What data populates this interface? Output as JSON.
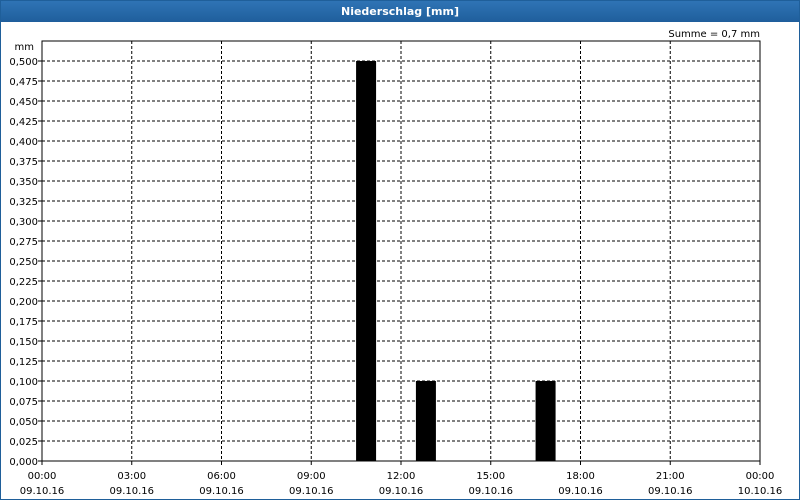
{
  "window": {
    "title": "Niederschlag [mm]"
  },
  "summary": "Summe = 0,7 mm",
  "chart_data": {
    "type": "bar",
    "title": "Niederschlag [mm]",
    "ylabel": "mm",
    "ylim": [
      0,
      0.5
    ],
    "yticks": [
      "0,000",
      "0,025",
      "0,050",
      "0,075",
      "0,100",
      "0,125",
      "0,150",
      "0,175",
      "0,200",
      "0,225",
      "0,250",
      "0,275",
      "0,300",
      "0,325",
      "0,350",
      "0,375",
      "0,400",
      "0,425",
      "0,450",
      "0,475",
      "0,500"
    ],
    "xlim_hours": [
      0,
      24
    ],
    "xticks": [
      {
        "time": "00:00",
        "date": "09.10.16"
      },
      {
        "time": "03:00",
        "date": "09.10.16"
      },
      {
        "time": "06:00",
        "date": "09.10.16"
      },
      {
        "time": "09:00",
        "date": "09.10.16"
      },
      {
        "time": "12:00",
        "date": "09.10.16"
      },
      {
        "time": "15:00",
        "date": "09.10.16"
      },
      {
        "time": "18:00",
        "date": "09.10.16"
      },
      {
        "time": "21:00",
        "date": "09.10.16"
      },
      {
        "time": "00:00",
        "date": "10.10.16"
      }
    ],
    "bars": [
      {
        "time": "11:00",
        "value": 0.5
      },
      {
        "time": "13:00",
        "value": 0.1
      },
      {
        "time": "17:00",
        "value": 0.1
      }
    ],
    "grid": true,
    "bar_color": "#000000"
  }
}
